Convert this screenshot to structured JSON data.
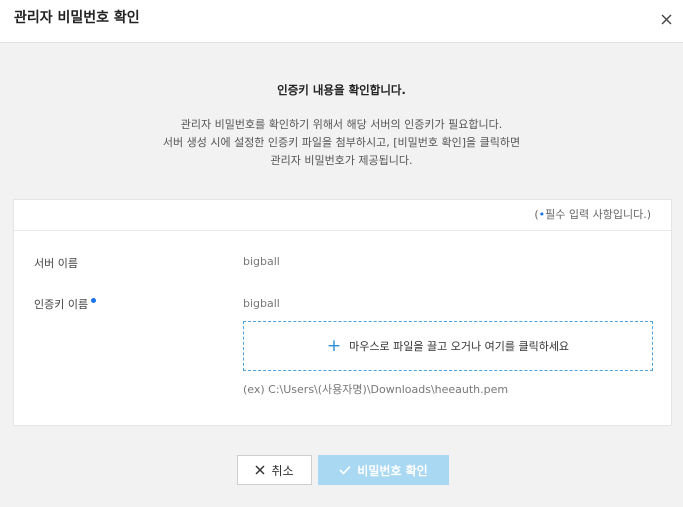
{
  "dialog": {
    "title": "관리자 비밀번호 확인"
  },
  "intro": {
    "heading": "인증키 내용을 확인합니다.",
    "lines": [
      "관리자 비밀번호를 확인하기 위해서 해당 서버의 인증키가 필요합니다.",
      "서버 생성 시에 설정한 인증키 파일을 첨부하시고, [비밀번호 확인]을 클릭하면",
      "관리자 비밀번호가 제공됩니다."
    ]
  },
  "form": {
    "required_note_open": "(",
    "required_note_dot": "•",
    "required_note_text": "필수 입력 사항입니다.)",
    "server_name_label": "서버 이름",
    "server_name_value": "bigball",
    "key_name_label": "인증키 이름",
    "key_name_value": "bigball",
    "dropzone_text": "마우스로 파일을 끌고 오거나 여기를 클릭하세요",
    "example_path": "(ex) C:\\Users\\(사용자명)\\Downloads\\heeauth.pem"
  },
  "buttons": {
    "cancel_label": "취소",
    "confirm_label": "비밀번호 확인"
  },
  "icons": {
    "close": "close-icon",
    "plus": "plus-icon",
    "cancel": "x-icon",
    "confirm": "check-icon"
  },
  "colors": {
    "accent": "#1a73e8",
    "confirm_button": "#a9d8f2",
    "dropzone_border": "#4aa3df"
  }
}
